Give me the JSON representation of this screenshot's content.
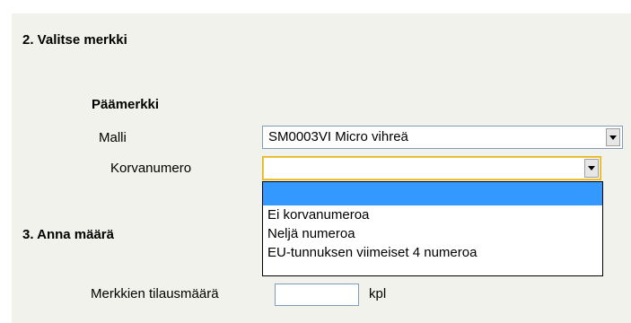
{
  "section2": {
    "title": "2. Valitse merkki",
    "subtitle": "Päämerkki",
    "model": {
      "label": "Malli",
      "selected": "SM0003VI Micro vihreä"
    },
    "ear_number": {
      "label": "Korvanumero",
      "selected": "",
      "options": [
        "",
        "Ei korvanumeroa",
        "Neljä numeroa",
        "EU-tunnuksen viimeiset 4 numeroa"
      ]
    }
  },
  "section3": {
    "title": "3. Anna määrä",
    "quantity": {
      "label": "Merkkien tilausmäärä",
      "value": "",
      "unit": "kpl"
    }
  },
  "icons": {
    "dropdown_arrow": "chevron-down-icon"
  },
  "colors": {
    "panel_background": "#f2f2ec",
    "selected_option": "#3399ff",
    "focus_border": "#e4b51c"
  }
}
